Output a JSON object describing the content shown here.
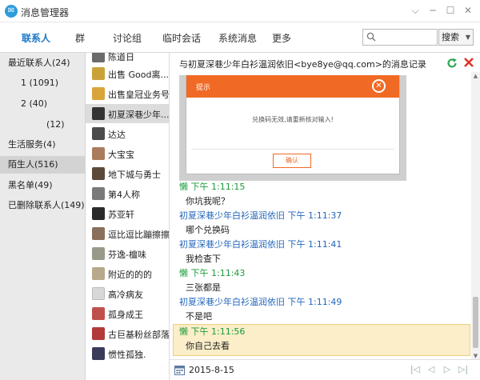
{
  "window": {
    "title": "消息管理器"
  },
  "nav": {
    "tabs": [
      "联系人",
      "群",
      "讨论组",
      "临时会话",
      "系统消息",
      "更多"
    ],
    "search_placeholder": "",
    "search_button": "搜索"
  },
  "sidebar": {
    "items": [
      "最近联系人(24)",
      "1 (1091)",
      "2 (40)",
      "(12)",
      "生活服务(4)",
      "陌生人(516)",
      "黑名单(49)",
      "已删除联系人(149)"
    ]
  },
  "contacts": [
    "陈道日",
    "出售 Good离...",
    "出售皇冠业务号",
    "初夏深巷少年...",
    "达达",
    "大宝宝",
    "地下城与勇士",
    "第4人称",
    "苏亚轩",
    "逗比逗比蹦擦擦",
    "芬逸-檀味",
    "附近的的的",
    "高冷病友",
    "孤身成王",
    "古巨基粉丝部落",
    "惯性孤独."
  ],
  "chat": {
    "header": "与初夏深巷少年白衫温润依旧<bye8ye@qq.com>的消息记录",
    "dialog": {
      "title": "提示",
      "message": "兑换码无效,请重新核对输入!",
      "button": "确认"
    },
    "messages": [
      {
        "sender": "懒",
        "time": "下午 1:11:15",
        "text": "你坑我呢？",
        "me": true
      },
      {
        "sender": "初夏深巷少年白衫温润依旧",
        "time": "下午 1:11:37",
        "text": "哪个兑换码",
        "me": false
      },
      {
        "sender": "初夏深巷少年白衫温润依旧",
        "time": "下午 1:11:41",
        "text": "我检查下",
        "me": false
      },
      {
        "sender": "懒",
        "time": "下午 1:11:43",
        "text": "三张都是",
        "me": true
      },
      {
        "sender": "初夏深巷少年白衫温润依旧",
        "time": "下午 1:11:49",
        "text": "不是吧",
        "me": false
      },
      {
        "sender": "懒",
        "time": "下午 1:11:56",
        "text": "你自己去看",
        "me": true
      }
    ],
    "footer_date": "2015-8-15"
  },
  "colors": {
    "accent": "#1e78c8",
    "dialog_orange": "#f06a25",
    "me_green": "#1a9b3a",
    "other_blue": "#2266bb",
    "highlight_bg": "#fbeec9"
  }
}
